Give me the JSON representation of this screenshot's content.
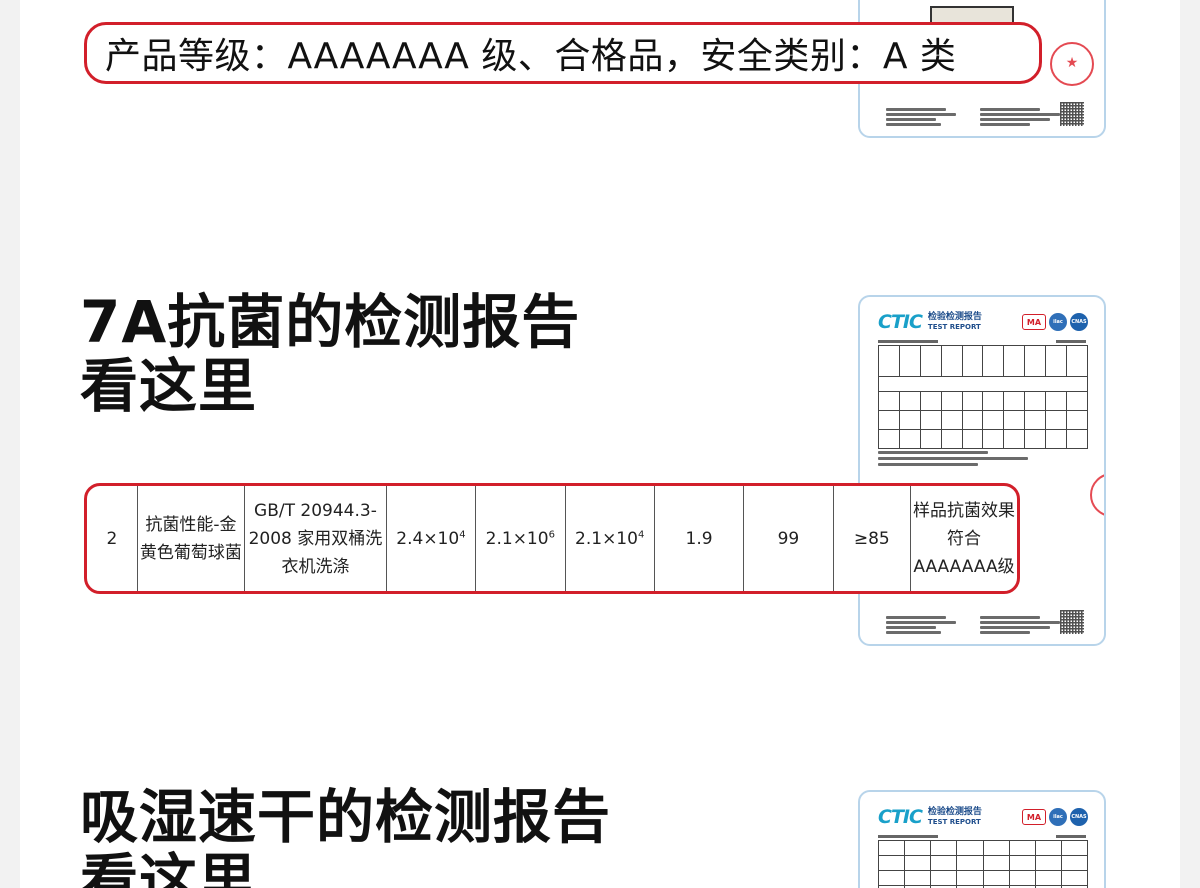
{
  "grade_banner": {
    "text": "产品等级：AAAAAAA 级、合格品，安全类别：A 类"
  },
  "section_antibacterial": {
    "title_line1": "7A抗菌的检测报告",
    "title_line2": "看这里"
  },
  "section_moisture": {
    "title_line1": "吸湿速干的检测报告",
    "title_line2": "看这里"
  },
  "report_card": {
    "logo_main": "CT",
    "logo_accent": "IC",
    "title_cn": "检验检测报告",
    "title_en": "TEST REPORT",
    "badge_ma": "MA",
    "badge_ilac": "ilac",
    "badge_cnas": "CNAS"
  },
  "result_row": {
    "no": "2",
    "item": "抗菌性能-金黄色葡萄球菌",
    "method": "GB/T 20944.3-2008 家用双桶洗衣机洗涤",
    "v1_base": "2.4×10",
    "v1_exp": "4",
    "v2_base": "2.1×10",
    "v2_exp": "6",
    "v3_base": "2.1×10",
    "v3_exp": "4",
    "v4": "1.9",
    "v5": "99",
    "v6": "≥85",
    "conclusion": "样品抗菌效果符合AAAAAAA级"
  },
  "colors": {
    "highlight_border": "#d21f2a",
    "report_border": "#b8d4ea",
    "logo_blue": "#1f4e8c"
  }
}
